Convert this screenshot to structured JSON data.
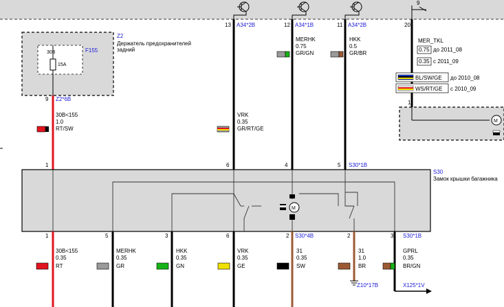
{
  "page": {
    "background": "#ffffff",
    "box_fill": "#d9d9d9"
  },
  "top": {
    "pin_9": "9",
    "pin_13": "13",
    "conn_13": "A34*2B",
    "pin_12": "12",
    "conn_12": "A34*1B",
    "pin_11": "11",
    "conn_11": "A34*2B",
    "pin_20": "20",
    "conn_mer": "MER_TKL",
    "ver_0_75_value": "0.75",
    "ver_0_75_text": "до 2011_08",
    "ver_0_35_value": "0.35",
    "ver_0_35_text": "с 2011_09",
    "legend_1_code": "BL/SW/GE",
    "legend_1_text": "до 2010_08",
    "legend_2_code": "WS/RT/GE",
    "legend_2_text": "с 2010_09",
    "pin_right_1": "1"
  },
  "fuse": {
    "id": "Z2",
    "name": "Держатель предохранителей задний",
    "name_line1": "Держатель предохранителей",
    "name_line2": "задний",
    "fuse_id": "F155",
    "fuse_label": "30B",
    "fuse_rating": "15A",
    "pin": "9",
    "conn": "Z2*6B"
  },
  "upper_wires": [
    {
      "name": "30B<155",
      "size": "1.0",
      "color_code": "RT/SW"
    },
    {
      "name": "VRK",
      "size": "0.35",
      "color_code": "GR/RT/GE"
    },
    {
      "name": "MERHK",
      "size": "0.75",
      "color_code": "GR/GN"
    },
    {
      "name": "HKK",
      "size": "0.5",
      "color_code": "GR/BR"
    }
  ],
  "s30": {
    "id": "S30",
    "name": "Замок крышки багажника",
    "pins_top": [
      "1",
      "6",
      "4",
      "5"
    ],
    "conn_top": "S30*1B",
    "pins_bottom": [
      "1",
      "5",
      "3",
      "6",
      "2",
      "2",
      "3"
    ],
    "conn_bottom_1": "S30*4B",
    "conn_bottom_2": "S30*1B"
  },
  "lower_wires": [
    {
      "name": "30B<155",
      "size": "0.35",
      "color_code": "RT"
    },
    {
      "name": "MERHK",
      "size": "0.35",
      "color_code": "GR"
    },
    {
      "name": "HKK",
      "size": "0.35",
      "color_code": "GN"
    },
    {
      "name": "VRK",
      "size": "0.35",
      "color_code": "GE"
    },
    {
      "name": "31",
      "size": "0.35",
      "color_code": "SW"
    },
    {
      "name": "31",
      "size": "1.0",
      "color_code": "BR"
    },
    {
      "name": "GPRL",
      "size": "0.35",
      "color_code": "BR/GN"
    }
  ],
  "bottom": {
    "ground_conn": "Z10*17B",
    "conn_x125": "X125*1V"
  },
  "wire_colors": {
    "RT": "#e0141e",
    "SW": "#000000",
    "GR": "#9a9a9a",
    "GN": "#16b316",
    "GE": "#f0e000",
    "BR": "#9c5a34",
    "BL": "#1a3cd6",
    "WS": "#ffffff"
  }
}
